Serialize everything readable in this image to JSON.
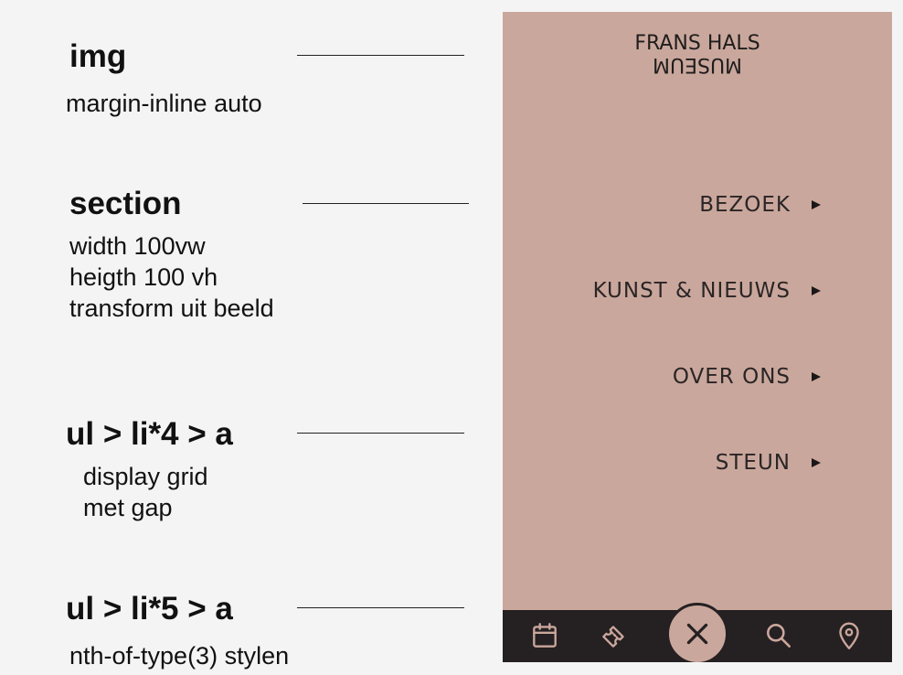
{
  "annotations": [
    {
      "title": "img",
      "lines": [
        "margin-inline auto"
      ]
    },
    {
      "title": "section",
      "lines": [
        "width 100vw",
        "heigth 100 vh",
        "transform uit beeld"
      ]
    },
    {
      "title": "ul > li*4 > a",
      "lines": [
        "display grid",
        "met gap"
      ]
    },
    {
      "title": "ul > li*5 > a",
      "lines": [
        "nth-of-type(3) stylen"
      ]
    }
  ],
  "phone": {
    "logo": {
      "line1": "FRANS HALS",
      "line2": "MUSEUM"
    },
    "menu": [
      {
        "label": "BEZOEK"
      },
      {
        "label": "KUNST & NIEUWS"
      },
      {
        "label": "OVER ONS"
      },
      {
        "label": "STEUN"
      }
    ],
    "tabbar": [
      "calendar-icon",
      "ticket-icon",
      "close-icon",
      "search-icon",
      "location-pin-icon"
    ]
  },
  "colors": {
    "background": "#f4f4f4",
    "phone": "#caa79c",
    "tabbar": "#252022",
    "text": "#111111",
    "icon": "#caa79c"
  }
}
